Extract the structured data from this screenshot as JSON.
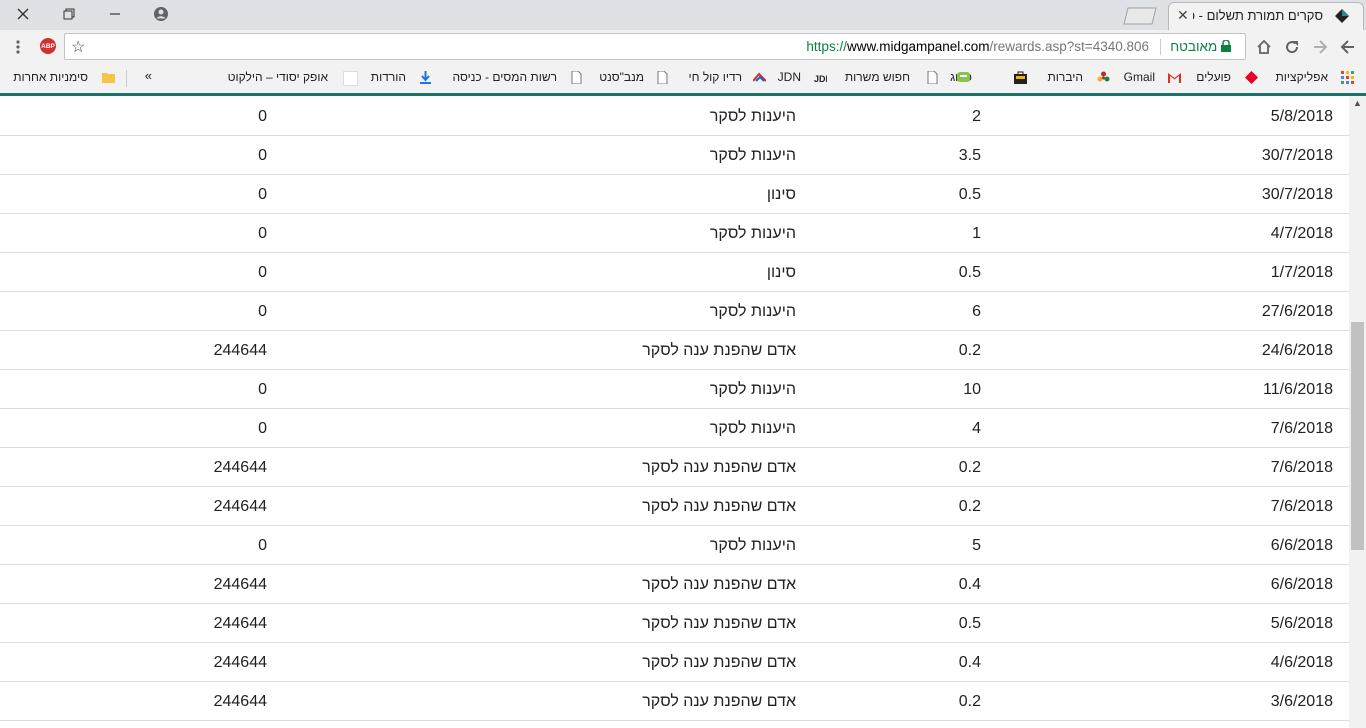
{
  "browser": {
    "tab_title": "סקרים תמורת תשלום - פ",
    "url_proto": "https://",
    "url_host": "www.midgampanel.com",
    "url_path": "/rewards.asp?st=4340.806",
    "secure_label": "מאובטח",
    "abp_label": "ABP"
  },
  "bookmarks": [
    {
      "label": "אפליקציות"
    },
    {
      "label": "פועלים"
    },
    {
      "label": "Gmail"
    },
    {
      "label": "היברות"
    },
    {
      "label": "פרוג"
    },
    {
      "label": "חפוש משרות"
    },
    {
      "label": "JDN"
    },
    {
      "label": "רדיו קול חי"
    },
    {
      "label": "מנב\"סנט"
    },
    {
      "label": "רשות המסים - כניסה"
    },
    {
      "label": "הורדות"
    },
    {
      "label": "אופק יסודי – הילקוט"
    },
    {
      "label": "סימניות אחרות"
    }
  ],
  "overflow_label": "»",
  "rows": [
    {
      "date": "5/8/2018",
      "amount": "2",
      "source": "היענות לסקר",
      "ref": "0"
    },
    {
      "date": "30/7/2018",
      "amount": "3.5",
      "source": "היענות לסקר",
      "ref": "0"
    },
    {
      "date": "30/7/2018",
      "amount": "0.5",
      "source": "סינון",
      "ref": "0"
    },
    {
      "date": "4/7/2018",
      "amount": "1",
      "source": "היענות לסקר",
      "ref": "0"
    },
    {
      "date": "1/7/2018",
      "amount": "0.5",
      "source": "סינון",
      "ref": "0"
    },
    {
      "date": "27/6/2018",
      "amount": "6",
      "source": "היענות לסקר",
      "ref": "0"
    },
    {
      "date": "24/6/2018",
      "amount": "0.2",
      "source": "אדם שהפנת ענה לסקר",
      "ref": "244644"
    },
    {
      "date": "11/6/2018",
      "amount": "10",
      "source": "היענות לסקר",
      "ref": "0"
    },
    {
      "date": "7/6/2018",
      "amount": "4",
      "source": "היענות לסקר",
      "ref": "0"
    },
    {
      "date": "7/6/2018",
      "amount": "0.2",
      "source": "אדם שהפנת ענה לסקר",
      "ref": "244644"
    },
    {
      "date": "7/6/2018",
      "amount": "0.2",
      "source": "אדם שהפנת ענה לסקר",
      "ref": "244644"
    },
    {
      "date": "6/6/2018",
      "amount": "5",
      "source": "היענות לסקר",
      "ref": "0"
    },
    {
      "date": "6/6/2018",
      "amount": "0.4",
      "source": "אדם שהפנת ענה לסקר",
      "ref": "244644"
    },
    {
      "date": "5/6/2018",
      "amount": "0.5",
      "source": "אדם שהפנת ענה לסקר",
      "ref": "244644"
    },
    {
      "date": "4/6/2018",
      "amount": "0.4",
      "source": "אדם שהפנת ענה לסקר",
      "ref": "244644"
    },
    {
      "date": "3/6/2018",
      "amount": "0.2",
      "source": "אדם שהפנת ענה לסקר",
      "ref": "244644"
    }
  ]
}
